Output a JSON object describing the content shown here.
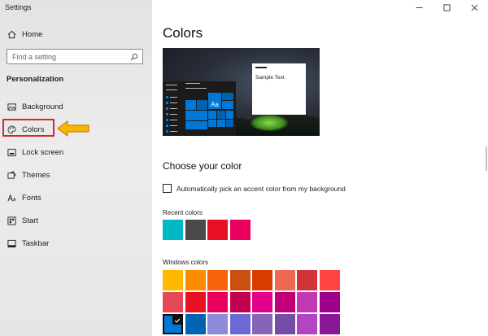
{
  "app_title": "Settings",
  "sidebar": {
    "home_label": "Home",
    "search_placeholder": "Find a setting",
    "section_heading": "Personalization",
    "items": [
      {
        "label": "Background",
        "icon": "image-icon"
      },
      {
        "label": "Colors",
        "icon": "palette-icon"
      },
      {
        "label": "Lock screen",
        "icon": "lock-screen-icon"
      },
      {
        "label": "Themes",
        "icon": "themes-icon"
      },
      {
        "label": "Fonts",
        "icon": "fonts-icon"
      },
      {
        "label": "Start",
        "icon": "start-icon"
      },
      {
        "label": "Taskbar",
        "icon": "taskbar-icon"
      }
    ],
    "selected_item": "Colors"
  },
  "main": {
    "title": "Colors",
    "preview": {
      "tile_text": "Aa",
      "sample_text": "Sample Text"
    },
    "choose_heading": "Choose your color",
    "auto_pick_label": "Automatically pick an accent color from my background",
    "auto_pick_checked": false,
    "recent_label": "Recent colors",
    "recent_colors": [
      "#00b7c3",
      "#4c4a48",
      "#e81123",
      "#ea005e"
    ],
    "windows_label": "Windows colors",
    "windows_colors": [
      [
        "#ffb900",
        "#ff8c00",
        "#f7630c",
        "#ca5010",
        "#da3b01",
        "#ef6950",
        "#d13438",
        "#ff4343"
      ],
      [
        "#e74856",
        "#e81123",
        "#ea005e",
        "#c30052",
        "#e3008c",
        "#bf0077",
        "#c239b3",
        "#9a0089"
      ],
      [
        "#0078d7",
        "#0063b1",
        "#8e8cd8",
        "#6b69d6",
        "#8764b8",
        "#744da9",
        "#b146c2",
        "#881798"
      ]
    ],
    "selected_color": "#0078d7"
  },
  "accent_color": "#0078d7",
  "highlight_color": "#d8262f",
  "arrow_color": "#f5b800"
}
